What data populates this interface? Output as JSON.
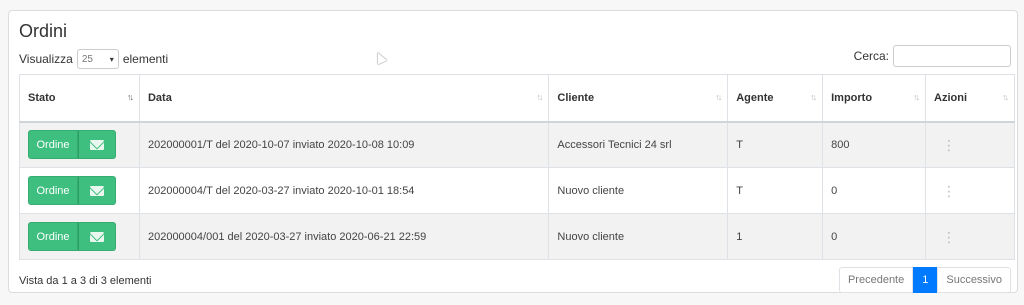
{
  "title": "Ordini",
  "length": {
    "prefix": "Visualizza",
    "value": "25",
    "suffix": "elementi"
  },
  "search": {
    "label": "Cerca:",
    "value": ""
  },
  "columns": [
    "Stato",
    "Data",
    "Cliente",
    "Agente",
    "Importo",
    "Azioni"
  ],
  "sort_icon": "↑↓",
  "rows": [
    {
      "stato_label": "Ordine",
      "data": "202000001/T del 2020-10-07 inviato 2020-10-08 10:09",
      "cliente": "Accessori Tecnici 24 srl",
      "agente": "T",
      "importo": "800"
    },
    {
      "stato_label": "Ordine",
      "data": "202000004/T del 2020-03-27 inviato 2020-10-01 18:54",
      "cliente": "Nuovo cliente",
      "agente": "T",
      "importo": "0"
    },
    {
      "stato_label": "Ordine",
      "data": "202000004/001 del 2020-03-27 inviato 2020-06-21 22:59",
      "cliente": "Nuovo cliente",
      "agente": "1",
      "importo": "0"
    }
  ],
  "info": "Vista da 1 a 3 di 3 elementi",
  "pager": {
    "prev": "Precedente",
    "current": "1",
    "next": "Successivo"
  },
  "colors": {
    "success": "#3fbf7f",
    "primary": "#007bff",
    "stripe": "#f2f2f2"
  },
  "icons": {
    "mail": "envelope-icon",
    "actions": "kebab-icon",
    "sort": "sort-icon"
  }
}
